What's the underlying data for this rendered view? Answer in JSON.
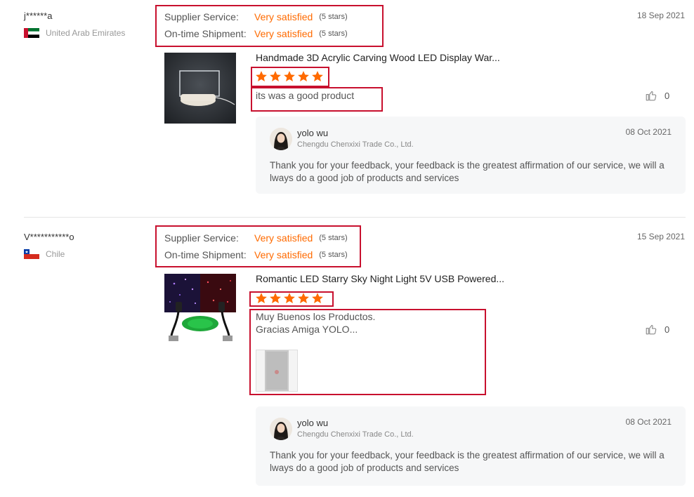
{
  "reviews": [
    {
      "buyer": "j******a",
      "country": "United Arab Emirates",
      "date": "18 Sep 2021",
      "supplier_service_label": "Supplier Service:",
      "supplier_service_value": "Very satisfied",
      "supplier_service_stars": "(5 stars)",
      "shipment_label": "On-time Shipment:",
      "shipment_value": "Very satisfied",
      "shipment_stars": "(5 stars)",
      "product_title": "Handmade 3D Acrylic Carving Wood LED Display War...",
      "rating": 5,
      "comment": "its was a good product",
      "likes": "0",
      "reply": {
        "name": "yolo wu",
        "company": "Chengdu Chenxixi Trade Co., Ltd.",
        "date": "08 Oct 2021",
        "text": "Thank you for your feedback, your feedback is the greatest affirmation of our service, we will a lways do a good job of products and services"
      }
    },
    {
      "buyer": "V***********o",
      "country": "Chile",
      "date": "15 Sep 2021",
      "supplier_service_label": "Supplier Service:",
      "supplier_service_value": "Very satisfied",
      "supplier_service_stars": "(5 stars)",
      "shipment_label": "On-time Shipment:",
      "shipment_value": "Very satisfied",
      "shipment_stars": "(5 stars)",
      "product_title": "Romantic LED Starry Sky Night Light 5V USB Powered...",
      "rating": 5,
      "comment_line1": "Muy Buenos los Productos.",
      "comment_line2": "Gracias Amiga YOLO...",
      "likes": "0",
      "reply": {
        "name": "yolo wu",
        "company": "Chengdu Chenxixi Trade Co., Ltd.",
        "date": "08 Oct 2021",
        "text": "Thank you for your feedback, your feedback is the greatest affirmation of our service, we will a lways do a good job of products and services"
      }
    }
  ],
  "colors": {
    "accent": "#ff6a00",
    "highlight_box": "#c8102e",
    "reply_bg": "#f6f7f8"
  },
  "icons": {
    "like": "thumbs-up-icon",
    "star": "star-icon"
  }
}
